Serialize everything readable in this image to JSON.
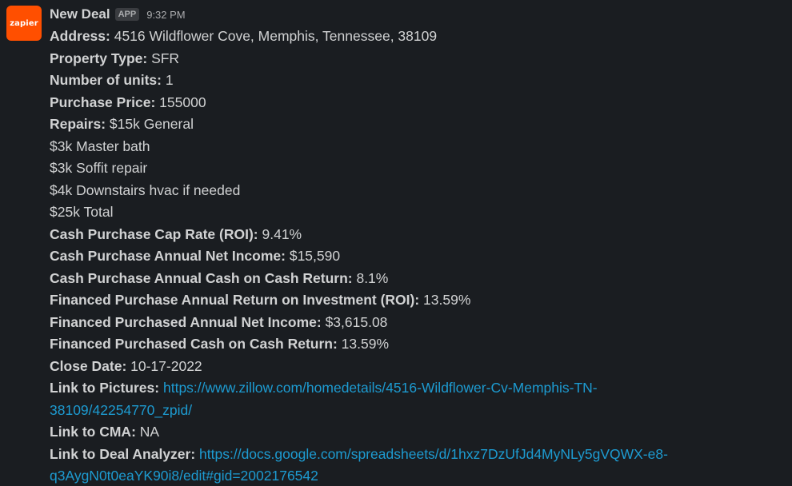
{
  "message": {
    "avatar_label": "zapier",
    "sender": "New Deal",
    "badge": "APP",
    "timestamp": "9:32 PM"
  },
  "fields": {
    "address": {
      "label": "Address:",
      "value": " 4516 Wildflower Cove, Memphis, Tennessee, 38109"
    },
    "property_type": {
      "label": "Property Type:",
      "value": " SFR"
    },
    "units": {
      "label": "Number of units:",
      "value": " 1"
    },
    "purchase_price": {
      "label": "Purchase Price:",
      "value": " 155000"
    },
    "repairs": {
      "label": "Repairs:",
      "value": " $15k General",
      "lines": [
        "$3k Master bath",
        "$3k Soffit repair",
        "$4k Downstairs hvac if needed",
        "$25k Total"
      ]
    },
    "cash_cap_rate": {
      "label": "Cash Purchase Cap Rate (ROI):",
      "value": " 9.41%"
    },
    "cash_net_income": {
      "label": "Cash Purchase Annual Net Income:",
      "value": " $15,590"
    },
    "cash_coc": {
      "label": "Cash Purchase Annual Cash on Cash Return:",
      "value": " 8.1%"
    },
    "fin_roi": {
      "label": "Financed Purchase Annual Return on Investment (ROI):",
      "value": " 13.59%"
    },
    "fin_net_income": {
      "label": "Financed Purchased Annual Net Income:",
      "value": " $3,615.08"
    },
    "fin_coc": {
      "label": "Financed Purchased Cash on Cash Return:",
      "value": " 13.59%"
    },
    "close_date": {
      "label": "Close Date:",
      "value": " 10-17-2022"
    },
    "pictures": {
      "label": "Link to Pictures:",
      "link_line1": "https://www.zillow.com/homedetails/4516-Wildflower-Cv-Memphis-TN-",
      "link_line2": "38109/42254770_zpid/"
    },
    "cma": {
      "label": "Link to CMA:",
      "value": " NA"
    },
    "deal_analyzer": {
      "label": "Link to Deal Analyzer:",
      "link_line1": "https://docs.google.com/spreadsheets/d/1hxz7DzUfJd4MyNLy5gVQWX-e8-",
      "link_line2": "q3AygN0t0eaYK90i8/edit#gid=2002176542"
    }
  },
  "colors": {
    "background": "#1a1d21",
    "text": "#d1d2d3",
    "link": "#1d9bd1",
    "avatar": "#ff4f00"
  }
}
